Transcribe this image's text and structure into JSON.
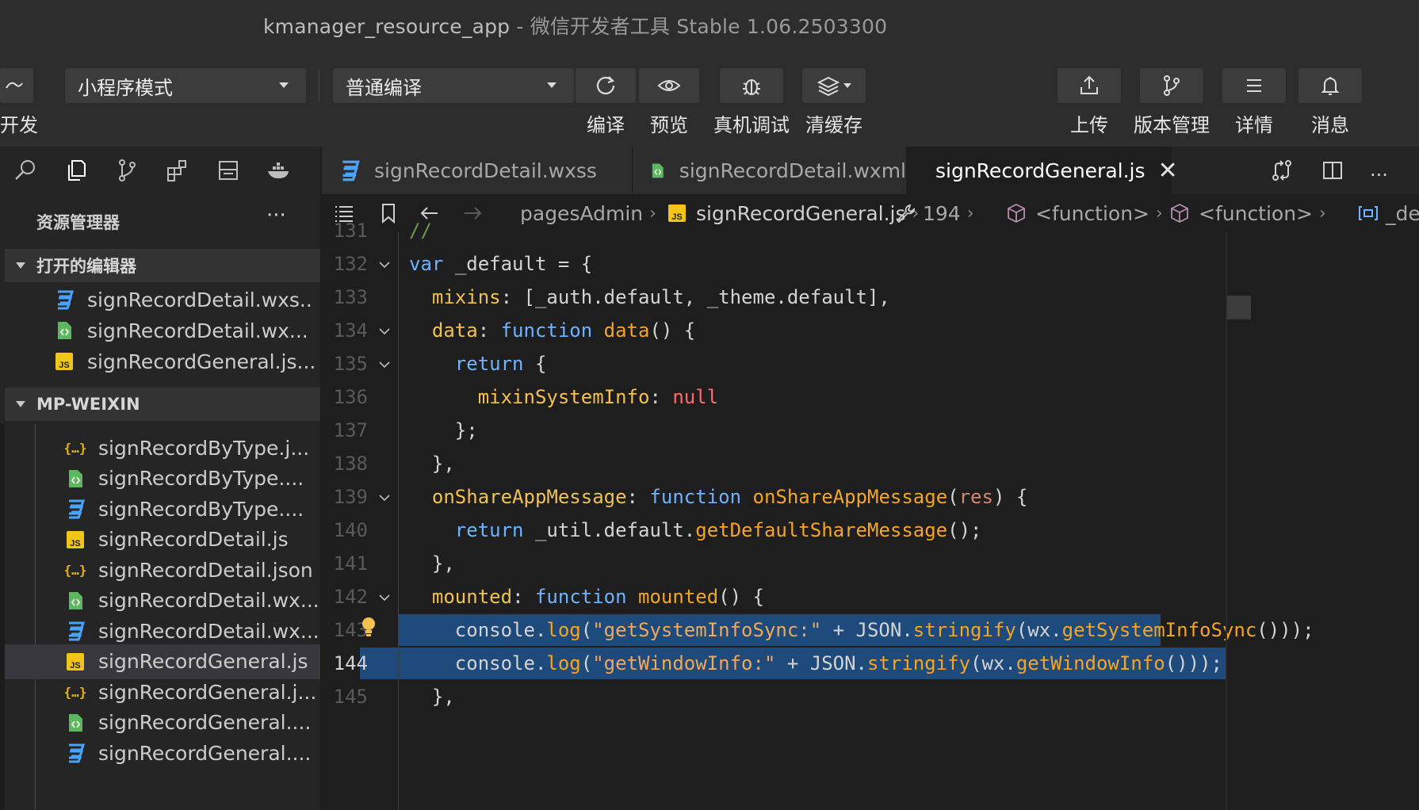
{
  "window": {
    "app_name": "kmanager_resource_app",
    "separator": "-",
    "tool_name": "微信开发者工具 Stable 1.06.2503300"
  },
  "toolbar": {
    "left_label": "开发",
    "mode_select": "小程序模式",
    "compile_select": "普通编译",
    "compile_label": "编译",
    "preview_label": "预览",
    "debug_label": "真机调试",
    "clear_cache_label": "清缓存",
    "upload_label": "上传",
    "version_label": "版本管理",
    "details_label": "详情",
    "message_label": "消息"
  },
  "sidebar": {
    "explorer_title": "资源管理器",
    "more": "···",
    "open_editors_title": "打开的编辑器",
    "open_editors": [
      {
        "name": "signRecordDetail.wxs...",
        "type": "wxss"
      },
      {
        "name": "signRecordDetail.wx...",
        "type": "wxml"
      },
      {
        "name": "signRecordGeneral.js...",
        "type": "js"
      }
    ],
    "project_title": "MP-WEIXIN",
    "files": [
      {
        "name": "signRecordByType.j...",
        "type": "json"
      },
      {
        "name": "signRecordByType....",
        "type": "wxml"
      },
      {
        "name": "signRecordByType....",
        "type": "wxss"
      },
      {
        "name": "signRecordDetail.js",
        "type": "js"
      },
      {
        "name": "signRecordDetail.json",
        "type": "json"
      },
      {
        "name": "signRecordDetail.wx...",
        "type": "wxml"
      },
      {
        "name": "signRecordDetail.wx...",
        "type": "wxss"
      },
      {
        "name": "signRecordGeneral.js",
        "type": "js"
      },
      {
        "name": "signRecordGeneral.j...",
        "type": "json"
      },
      {
        "name": "signRecordGeneral....",
        "type": "wxml"
      },
      {
        "name": "signRecordGeneral....",
        "type": "wxss"
      }
    ]
  },
  "tabs": [
    {
      "label": "signRecordDetail.wxss",
      "type": "wxss"
    },
    {
      "label": "signRecordDetail.wxml",
      "type": "wxml"
    },
    {
      "label": "signRecordGeneral.js",
      "type": "js",
      "close": "✕"
    }
  ],
  "breadcrumb": {
    "folder": "pagesAdmin",
    "file": "signRecordGeneral.js",
    "line": "194",
    "fn1": "<function>",
    "fn2": "<function>",
    "tail": "_de"
  },
  "editor": {
    "lines": [
      {
        "num": "131",
        "text": "//"
      },
      {
        "num": "132",
        "text": "var _default = {"
      },
      {
        "num": "133",
        "text": "  mixins: [_auth.default, _theme.default],"
      },
      {
        "num": "134",
        "text": "  data: function data() {"
      },
      {
        "num": "135",
        "text": "    return {"
      },
      {
        "num": "136",
        "text": "      mixinSystemInfo: null"
      },
      {
        "num": "137",
        "text": "    };"
      },
      {
        "num": "138",
        "text": "  },"
      },
      {
        "num": "139",
        "text": "  onShareAppMessage: function onShareAppMessage(res) {"
      },
      {
        "num": "140",
        "text": "    return _util.default.getDefaultShareMessage();"
      },
      {
        "num": "141",
        "text": "  },"
      },
      {
        "num": "142",
        "text": "  mounted: function mounted() {"
      },
      {
        "num": "143",
        "text": "    console.log(\"getSystemInfoSync:\" + JSON.stringify(wx.getSystemInfoSync()));"
      },
      {
        "num": "144",
        "text": "    console.log(\"getWindowInfo:\" + JSON.stringify(wx.getWindowInfo()));"
      },
      {
        "num": "145",
        "text": "  },"
      }
    ],
    "current_line": "144"
  },
  "colors": {
    "selection": "#1e4a7c",
    "keyword": "#6fb3ff",
    "property": "#f2c14e",
    "string": "#f0a85a",
    "null": "#ff6b6b"
  }
}
